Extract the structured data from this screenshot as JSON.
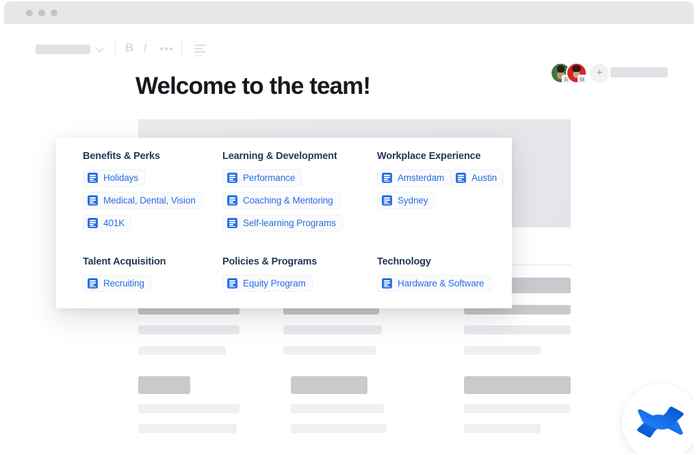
{
  "window": {
    "traffic_lights": [
      "close",
      "minimize",
      "maximize"
    ]
  },
  "toolbar": {
    "style_select_value": "",
    "bold_label": "B",
    "italic_label": "I",
    "more_label": "•••",
    "align_icon": "text-align-icon",
    "share_pill_value": ""
  },
  "collaborators": {
    "avatars": [
      {
        "name": "avatar-1",
        "presence_badge": "R"
      },
      {
        "name": "avatar-2",
        "presence_badge": "M"
      }
    ],
    "add_label": "+"
  },
  "page": {
    "title": "Welcome to the team!"
  },
  "nav_card": {
    "columns": [
      {
        "title": "Benefits & Perks",
        "links": [
          "Holidays",
          "Medical, Dental, Vision",
          "401K"
        ]
      },
      {
        "title": "Learning & Development",
        "links": [
          "Performance",
          "Coaching & Mentoring",
          "Self-learning Programs"
        ]
      },
      {
        "title": "Workplace Experience",
        "links": [
          "Amsterdam",
          "Austin",
          "Sydney"
        ]
      },
      {
        "title": "Talent Acquisition",
        "links": [
          "Recruiting"
        ]
      },
      {
        "title": "Policies & Programs",
        "links": [
          "Equity Program"
        ]
      },
      {
        "title": "Technology",
        "links": [
          "Hardware & Software"
        ]
      }
    ]
  },
  "branding": {
    "logo": "confluence-logo"
  },
  "colors": {
    "link_blue": "#2a6ce0",
    "icon_blue": "#2a72e5",
    "heading_navy": "#253858",
    "title_black": "#16191d",
    "chrome_gray": "#e7e7e8",
    "skeleton_head": "#c9cacd",
    "skeleton_line": "#e9eaee",
    "confluence_blue": "#1868db"
  }
}
